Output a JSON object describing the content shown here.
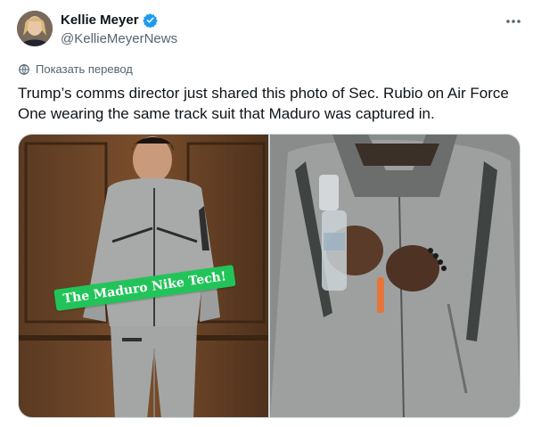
{
  "author": {
    "display_name": "Kellie Meyer",
    "handle": "@KellieMeyerNews",
    "verified_color": "#1d9bf0"
  },
  "translate_link": "Показать перевод",
  "tweet": {
    "text": "Trump’s comms director just shared this photo of Sec. Rubio on Air Force One wearing the same track suit that Maduro was captured in."
  },
  "media": {
    "left_photo_sticker": "The Maduro Nike Tech!",
    "sticker_color": "#22c45a"
  },
  "icons": [
    "verified-badge-icon",
    "more-options-icon",
    "globe-translate-icon"
  ]
}
